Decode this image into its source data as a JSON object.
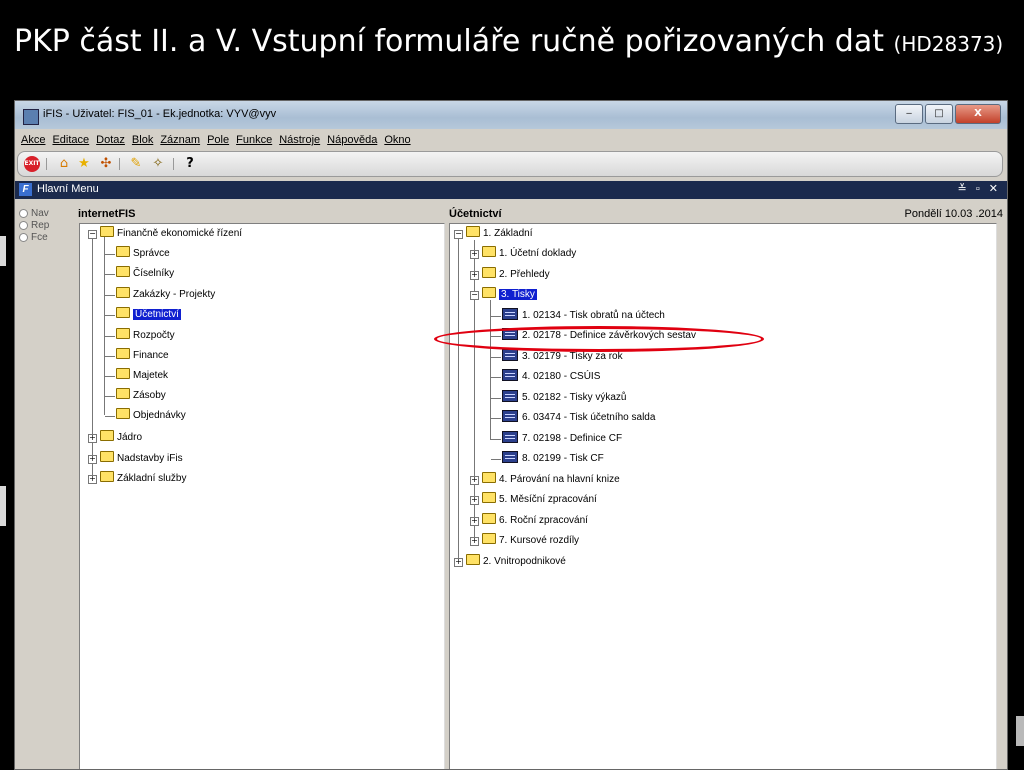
{
  "slide": {
    "title": "PKP část II. a V. Vstupní formuláře ručně pořizovaných dat",
    "code": "(HD28373)"
  },
  "window": {
    "title": "iFIS - Uživatel: FIS_01 - Ek.jednotka: VYV@vyv",
    "minimize": "‒",
    "maximize": "□",
    "close": "X"
  },
  "menu": [
    "Akce",
    "Editace",
    "Dotaz",
    "Blok",
    "Záznam",
    "Pole",
    "Funkce",
    "Nástroje",
    "Nápověda",
    "Okno"
  ],
  "toolbar": {
    "exit_label": "EXIT",
    "help_label": "?"
  },
  "inner": {
    "title": "Hlavní Menu",
    "controls": "≚ ▫ ✕"
  },
  "modes": [
    "Nav",
    "Rep",
    "Fce"
  ],
  "left_pane": {
    "label": "internetFIS",
    "root": "Finančně ekonomické řízení",
    "children": [
      "Správce",
      "Číselníky",
      "Zakázky - Projekty",
      "Účetnictví",
      "Rozpočty",
      "Finance",
      "Majetek",
      "Zásoby",
      "Objednávky"
    ],
    "siblings": [
      "Jádro",
      "Nadstavby iFis",
      "Základní služby"
    ]
  },
  "right_pane": {
    "label": "Účetnictví",
    "date": "Pondělí 10.03 .2014",
    "root": "1. Základní",
    "groups_before": [
      "1. Účetní doklady",
      "2. Přehledy"
    ],
    "selected_group": "3. Tisky",
    "forms": [
      "1. 02134 - Tisk obratů na účtech",
      "2. 02178 - Definice závěrkových sestav",
      "3. 02179 - Tisky za rok",
      "4. 02180 - CSÚIS",
      "5. 02182 - Tisky výkazů",
      "6. 03474 - Tisk účetního salda",
      "7. 02198 - Definice CF",
      "8. 02199 - Tisk CF"
    ],
    "groups_after": [
      "4. Párování na hlavní knize",
      "5. Měsíční zpracování",
      "6. Roční zpracování",
      "7. Kursové rozdíly"
    ],
    "root2": "2. Vnitropodnikové"
  },
  "colors": {
    "selection": "#1020d0",
    "highlight": "#e00010",
    "titlebar": "#1b2a4d"
  }
}
